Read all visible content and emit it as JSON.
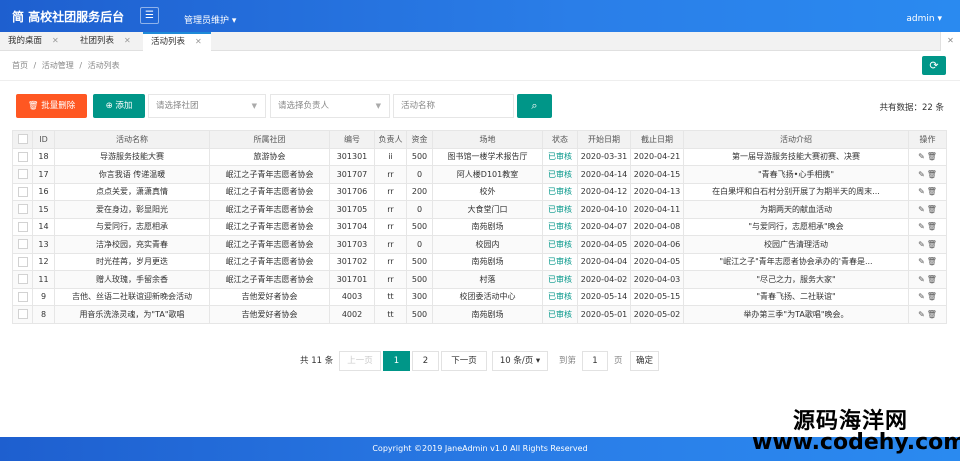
{
  "header": {
    "brand": "简 高校社团服务后台",
    "menu_icon": "hamburger-icon",
    "admin_menu": "管理员维护 ▾",
    "user_menu": "admin ▾"
  },
  "tabs": [
    {
      "label": "我的桌面",
      "close": "✕"
    },
    {
      "label": "社团列表",
      "close": "✕"
    },
    {
      "label": "活动列表",
      "close": "✕"
    }
  ],
  "tab_close_all": "✕",
  "breadcrumb": [
    "首页",
    "/",
    "活动管理",
    "/",
    "活动列表"
  ],
  "toolbar": {
    "delete_label": "🗑 批量删除",
    "add_label": "⊕ 添加",
    "club_placeholder": "请选择社团",
    "person_placeholder": "请选择负责人",
    "name_placeholder": "活动名称",
    "search_icon": "search-icon",
    "total_text": "共有数据：22 条"
  },
  "table": {
    "headers": [
      "",
      "ID",
      "活动名称",
      "所属社团",
      "编号",
      "负责人",
      "资金",
      "场地",
      "状态",
      "开始日期",
      "截止日期",
      "活动介绍",
      "操作"
    ],
    "rows": [
      [
        "18",
        "导游服务技能大赛",
        "旅游协会",
        "301301",
        "ii",
        "500",
        "图书馆一楼学术报告厅",
        "已审核",
        "2020-03-31",
        "2020-04-21",
        "第一届导游服务技能大赛初赛、决赛"
      ],
      [
        "17",
        "你言我语 传递温暖",
        "岷江之子青年志愿者协会",
        "301707",
        "rr",
        "0",
        "阿人楼D101教室",
        "已审核",
        "2020-04-14",
        "2020-04-15",
        "\"青春飞扬•心手相携\""
      ],
      [
        "16",
        "点点关爱，潇潇真情",
        "岷江之子青年志愿者协会",
        "301706",
        "rr",
        "200",
        "校外",
        "已审核",
        "2020-04-12",
        "2020-04-13",
        "在白果坪和白石村分别开展了为期半天的周末..."
      ],
      [
        "15",
        "爱在身边，彰显阳光",
        "岷江之子青年志愿者协会",
        "301705",
        "rr",
        "0",
        "大食堂门口",
        "已审核",
        "2020-04-10",
        "2020-04-11",
        "为期两天的献血活动"
      ],
      [
        "14",
        "与爱同行，志愿相承",
        "岷江之子青年志愿者协会",
        "301704",
        "rr",
        "500",
        "南苑剧场",
        "已审核",
        "2020-04-07",
        "2020-04-08",
        "\"与爱同行，志愿相承\"晚会"
      ],
      [
        "13",
        "洁净校园，充实青春",
        "岷江之子青年志愿者协会",
        "301703",
        "rr",
        "0",
        "校园内",
        "已审核",
        "2020-04-05",
        "2020-04-06",
        "校园广告清理活动"
      ],
      [
        "12",
        "时光荏苒，岁月更迭",
        "岷江之子青年志愿者协会",
        "301702",
        "rr",
        "500",
        "南苑剧场",
        "已审核",
        "2020-04-04",
        "2020-04-05",
        "\"岷江之子\"青年志愿者协会承办的'青春是..."
      ],
      [
        "11",
        "赠人玫瑰，手留余香",
        "岷江之子青年志愿者协会",
        "301701",
        "rr",
        "500",
        "村落",
        "已审核",
        "2020-04-02",
        "2020-04-03",
        "\"尽己之力，服务大家\""
      ],
      [
        "9",
        "吉他、丝语二社联谊迎新晚会活动",
        "吉他爱好者协会",
        "4003",
        "tt",
        "300",
        "校团委活动中心",
        "已审核",
        "2020-05-14",
        "2020-05-15",
        "\"青春飞扬、二社联谊\""
      ],
      [
        "8",
        "用音乐洗涤灵魂，为\"TA\"歌唱",
        "吉他爱好者协会",
        "4002",
        "tt",
        "500",
        "南苑剧场",
        "已审核",
        "2020-05-01",
        "2020-05-02",
        "举办第三季\"为TA歌唱\"晚会。"
      ]
    ]
  },
  "pagination": {
    "total": "共 11 条",
    "prev": "上一页",
    "page1": "1",
    "page2": "2",
    "next": "下一页",
    "page_size": "10 条/页",
    "goto_label": "到第",
    "goto_value": "1",
    "page_unit": "页",
    "confirm": "确定"
  },
  "footer": "Copyright ©2019 JaneAdmin v1.0 All Rights Reserved",
  "watermark": {
    "line1": "源码海洋网",
    "line2": "www.codehy.com"
  },
  "colors": {
    "primary": "#009688",
    "danger": "#ff5722",
    "header": "#2a7ee8"
  }
}
